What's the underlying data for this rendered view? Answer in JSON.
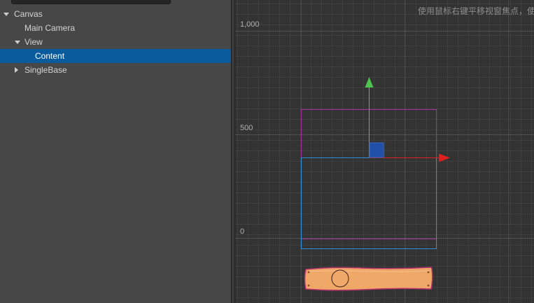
{
  "hierarchy": {
    "items": [
      {
        "label": "Canvas",
        "expanded": true
      },
      {
        "label": "Main Camera"
      },
      {
        "label": "View",
        "expanded": true
      },
      {
        "label": "Content",
        "selected": true
      },
      {
        "label": "SingleBase",
        "expanded": false
      }
    ]
  },
  "scene": {
    "hint": "使用鼠标右键平移视窗焦点，使",
    "axis_labels": {
      "y1000": "1,000",
      "y500": "500",
      "y0": "0"
    },
    "colors": {
      "selection": "#0a5a9e",
      "gizmo_x": "#e0201e",
      "gizmo_y": "#4fc14f",
      "gizmo_center": "#1f4fa6",
      "canvas_rect": "#a0309a",
      "content_rect": "#2f8fd8",
      "plank": "#f0a868"
    },
    "icons": [
      "move-gizmo-x-arrow-icon",
      "move-gizmo-y-arrow-icon",
      "move-gizmo-center-icon"
    ]
  }
}
